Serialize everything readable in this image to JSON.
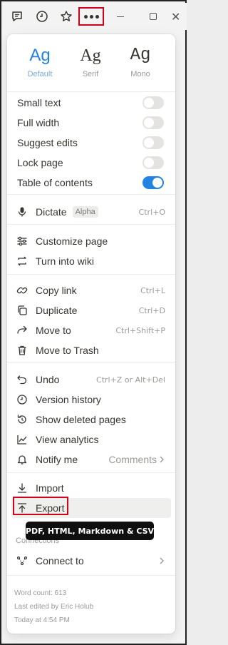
{
  "titlebar": {
    "icons": [
      "comment-icon",
      "clock-icon",
      "star-icon",
      "more-icon"
    ],
    "window_controls": [
      "minimize",
      "maximize",
      "close"
    ]
  },
  "fonts": [
    {
      "glyph": "Ag",
      "label": "Default",
      "selected": true
    },
    {
      "glyph": "Ag",
      "label": "Serif",
      "selected": false
    },
    {
      "glyph": "Ag",
      "label": "Mono",
      "selected": false
    }
  ],
  "toggles": [
    {
      "label": "Small text",
      "on": false
    },
    {
      "label": "Full width",
      "on": false
    },
    {
      "label": "Suggest edits",
      "on": false
    },
    {
      "label": "Lock page",
      "on": false
    },
    {
      "label": "Table of contents",
      "on": true
    }
  ],
  "dictate": {
    "label": "Dictate",
    "badge": "Alpha",
    "shortcut": "Ctrl+O"
  },
  "page_actions": [
    {
      "label": "Customize page",
      "icon": "sliders-icon"
    },
    {
      "label": "Turn into wiki",
      "icon": "convert-icon"
    }
  ],
  "edit_actions": [
    {
      "label": "Copy link",
      "icon": "link-icon",
      "shortcut": "Ctrl+L"
    },
    {
      "label": "Duplicate",
      "icon": "duplicate-icon",
      "shortcut": "Ctrl+D"
    },
    {
      "label": "Move to",
      "icon": "move-arrow-icon",
      "shortcut": "Ctrl+Shift+P"
    },
    {
      "label": "Move to Trash",
      "icon": "trash-icon",
      "shortcut": ""
    }
  ],
  "history_actions": [
    {
      "label": "Undo",
      "icon": "undo-icon",
      "shortcut": "Ctrl+Z or Alt+Del"
    },
    {
      "label": "Version history",
      "icon": "history-icon",
      "shortcut": ""
    },
    {
      "label": "Show deleted pages",
      "icon": "deleted-pages-icon",
      "shortcut": ""
    },
    {
      "label": "View analytics",
      "icon": "analytics-icon",
      "shortcut": ""
    }
  ],
  "notify": {
    "label": "Notify me",
    "value": "Comments"
  },
  "import_label": "Import",
  "export_label": "Export",
  "export_tooltip": "PDF, HTML, Markdown & CSV",
  "connections": {
    "section": "Connections",
    "label": "Connect to"
  },
  "footer": {
    "word_count": "Word count: 613",
    "last_edited": "Last edited by Eric Holub",
    "time": "Today at 4:54 PM"
  },
  "colors": {
    "accent": "#2383e2",
    "highlight_box": "#d0021b",
    "tooltip_bg": "#0f0f0f"
  }
}
